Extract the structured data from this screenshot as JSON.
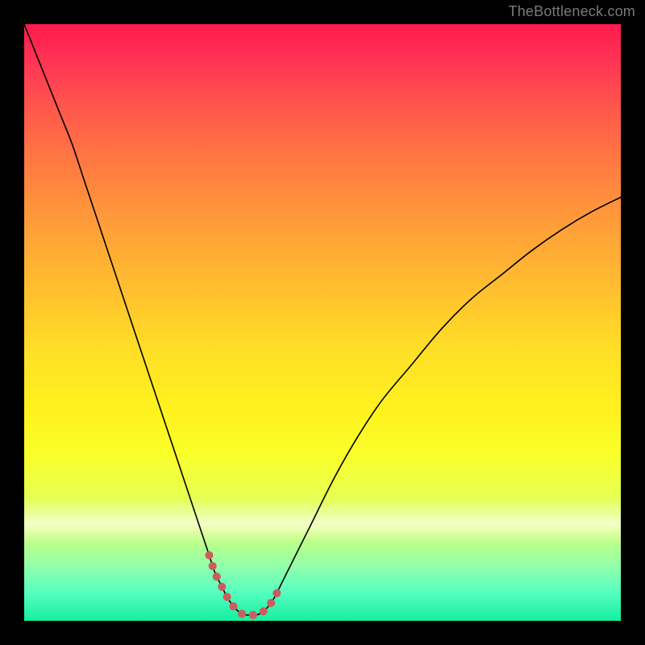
{
  "watermark": {
    "text": "TheBottleneck.com"
  },
  "colors": {
    "curve": "#000000",
    "highlight": "#cd5c5c",
    "frame": "#000000"
  },
  "chart_data": {
    "type": "line",
    "title": "",
    "xlabel": "",
    "ylabel": "",
    "xlim": [
      0,
      100
    ],
    "ylim": [
      0,
      100
    ],
    "grid": false,
    "series": [
      {
        "name": "bottleneck-curve",
        "x": [
          0,
          2,
          4,
          6,
          8,
          10,
          12,
          14,
          16,
          18,
          20,
          22,
          24,
          26,
          28,
          30,
          31,
          32,
          33,
          34,
          35,
          36,
          37,
          38,
          39,
          40,
          41,
          42,
          43,
          45,
          48,
          52,
          56,
          60,
          65,
          70,
          75,
          80,
          85,
          90,
          95,
          100
        ],
        "y": [
          100,
          95,
          90,
          85,
          80,
          74,
          68,
          62,
          56,
          50,
          44,
          38,
          32,
          26,
          20,
          14,
          11,
          8,
          6,
          4,
          2.5,
          1.5,
          1,
          1,
          1,
          1.5,
          2.5,
          4,
          6,
          10,
          16,
          24,
          31,
          37,
          43,
          49,
          54,
          58,
          62,
          65.5,
          68.5,
          71
        ]
      }
    ],
    "highlight_segment": {
      "note": "thick red dotted segment near trough",
      "x": [
        31,
        32,
        33,
        34,
        35,
        36,
        37,
        38,
        39,
        40,
        41,
        42,
        43
      ],
      "y": [
        11,
        8,
        6,
        4,
        2.5,
        1.5,
        1,
        1,
        1,
        1.5,
        2.5,
        4,
        6
      ]
    }
  }
}
